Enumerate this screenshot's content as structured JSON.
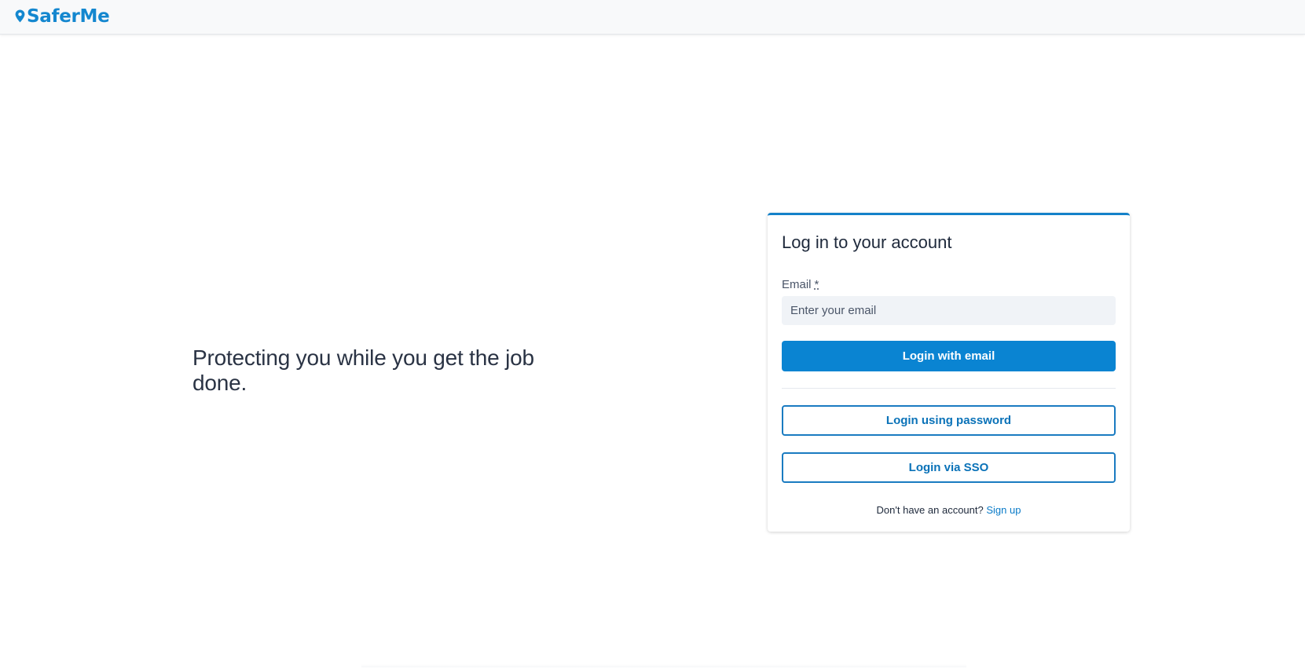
{
  "header": {
    "logo_text": "SaferMe",
    "logo_icon": "map-pin-icon",
    "brand_color": "#1487cf"
  },
  "hero": {
    "tagline": "Protecting you while you get the job done."
  },
  "login_card": {
    "title": "Log in to your account",
    "accent_color": "#1481c9",
    "email_label": "Email",
    "email_required_marker": "*",
    "email_placeholder": "Enter your email",
    "email_value": "",
    "login_email_label": "Login with email",
    "login_password_label": "Login using password",
    "login_sso_label": "Login via SSO",
    "signup_prompt": "Don't have an account?",
    "signup_link": "Sign up"
  }
}
